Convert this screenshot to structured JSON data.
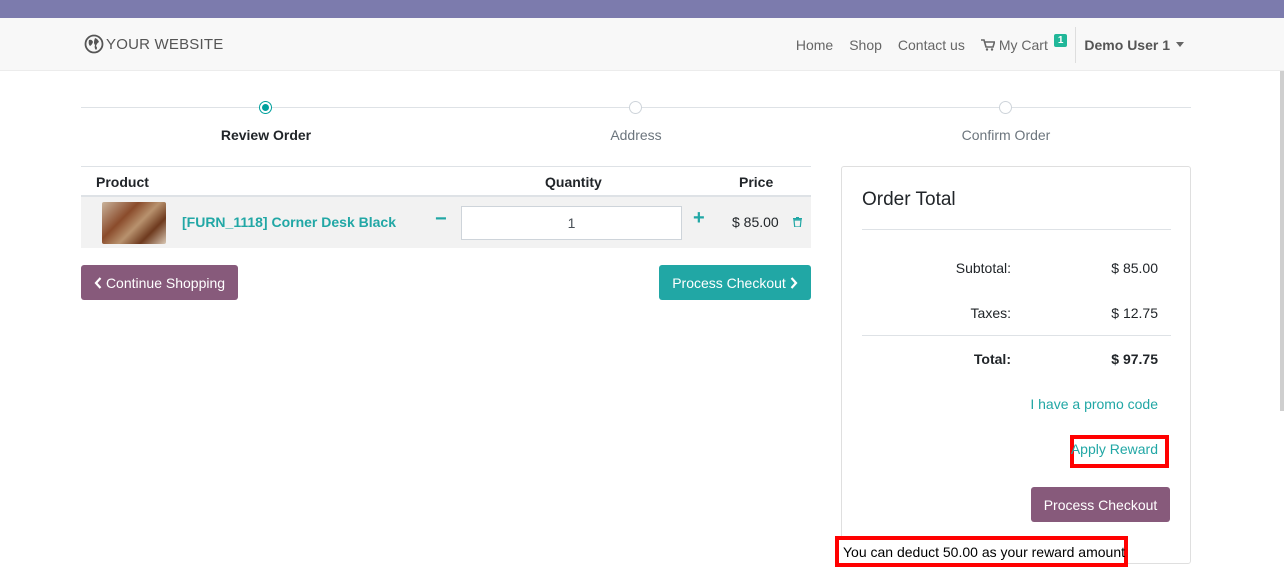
{
  "brand": {
    "name": "YOUR WEBSITE",
    "icon": "globe-icon"
  },
  "nav": {
    "home": "Home",
    "shop": "Shop",
    "contact": "Contact us",
    "cart_label": "My Cart",
    "cart_count": "1",
    "user": "Demo User 1"
  },
  "steps": [
    {
      "label": "Review Order",
      "active": true
    },
    {
      "label": "Address",
      "active": false
    },
    {
      "label": "Confirm Order",
      "active": false
    }
  ],
  "cart": {
    "headers": {
      "product": "Product",
      "quantity": "Quantity",
      "price": "Price"
    },
    "items": [
      {
        "name": "[FURN_1118] Corner Desk Black",
        "quantity": "1",
        "price": "$ 85.00"
      }
    ],
    "qty_minus": "−",
    "qty_plus": "+"
  },
  "buttons": {
    "continue_shopping": "Continue Shopping",
    "process_checkout": "Process Checkout"
  },
  "order_total": {
    "title": "Order Total",
    "subtotal_label": "Subtotal:",
    "subtotal": "$ 85.00",
    "taxes_label": "Taxes:",
    "taxes": "$ 12.75",
    "total_label": "Total:",
    "total": "$ 97.75",
    "promo_link": "I have a promo code",
    "apply_reward": "Apply Reward",
    "checkout_button": "Process Checkout"
  },
  "reward_message": "You can deduct 50.00 as your reward amount",
  "colors": {
    "topbar": "#7c7bad",
    "primary": "#875a7b",
    "accent": "#21a7a5",
    "highlight": "#ff0000"
  }
}
